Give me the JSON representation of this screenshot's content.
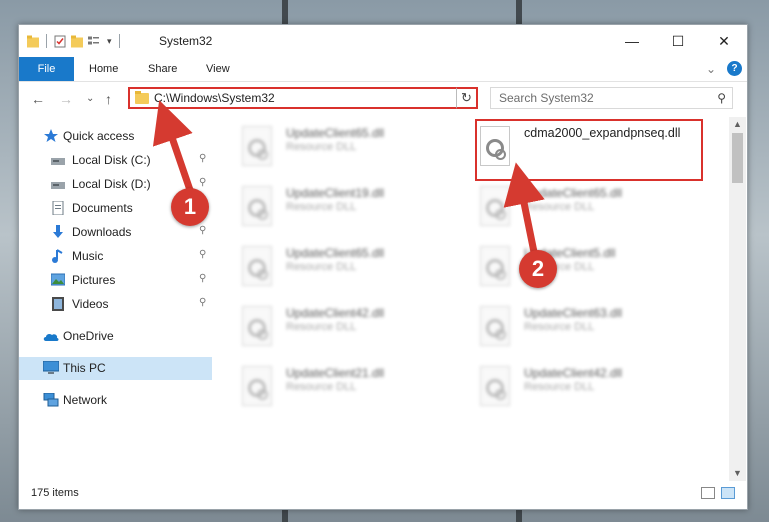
{
  "window": {
    "title": "System32",
    "minimize_glyph": "—",
    "maximize_glyph": "☐",
    "close_glyph": "✕"
  },
  "ribbon": {
    "file_label": "File",
    "tabs": [
      "Home",
      "Share",
      "View"
    ],
    "collapse_glyph": "⌄",
    "help_glyph": "?"
  },
  "navigation": {
    "back_glyph": "←",
    "forward_glyph": "→",
    "recent_glyph": "⌄",
    "up_glyph": "↑",
    "address_path": "C:\\Windows\\System32",
    "address_dropdown_glyph": "⌄",
    "refresh_glyph": "↻",
    "search_placeholder": "Search System32",
    "search_glyph": "⚲"
  },
  "sidebar": {
    "quick_access": "Quick access",
    "items": [
      {
        "label": "Local Disk (C:)",
        "icon": "drive-icon",
        "pinned": true
      },
      {
        "label": "Local Disk (D:)",
        "icon": "drive-icon",
        "pinned": true
      },
      {
        "label": "Documents",
        "icon": "documents-icon",
        "pinned": true
      },
      {
        "label": "Downloads",
        "icon": "downloads-icon",
        "pinned": true
      },
      {
        "label": "Music",
        "icon": "music-icon",
        "pinned": true
      },
      {
        "label": "Pictures",
        "icon": "pictures-icon",
        "pinned": true
      },
      {
        "label": "Videos",
        "icon": "videos-icon",
        "pinned": true
      }
    ],
    "onedrive": "OneDrive",
    "this_pc": "This PC",
    "network": "Network",
    "pin_glyph": "📌"
  },
  "files": {
    "left_column": [
      {
        "name": "UpdateClient65.dll",
        "type": "Resource DLL"
      },
      {
        "name": "UpdateClient19.dll",
        "type": "Resource DLL"
      },
      {
        "name": "UpdateClient65.dll",
        "type": "Resource DLL"
      },
      {
        "name": "UpdateClient42.dll",
        "type": "Resource DLL"
      },
      {
        "name": "UpdateClient21.dll",
        "type": "Resource DLL"
      }
    ],
    "right_column": [
      {
        "name": "cdma2000_expandpnseq.dll",
        "type": ""
      },
      {
        "name": "UpdateClient65.dll",
        "type": "Resource DLL"
      },
      {
        "name": "UpdateClient5.dll",
        "type": "Resource DLL"
      },
      {
        "name": "UpdateClient63.dll",
        "type": "Resource DLL"
      },
      {
        "name": "UpdateClient42.dll",
        "type": "Resource DLL"
      }
    ]
  },
  "status": {
    "item_count": "175 items"
  },
  "callouts": {
    "one": "1",
    "two": "2"
  },
  "colors": {
    "accent_blue": "#1979ca",
    "callout_red": "#d53a30",
    "highlight_red": "#d9312c",
    "selected_bg": "#cce4f7"
  }
}
